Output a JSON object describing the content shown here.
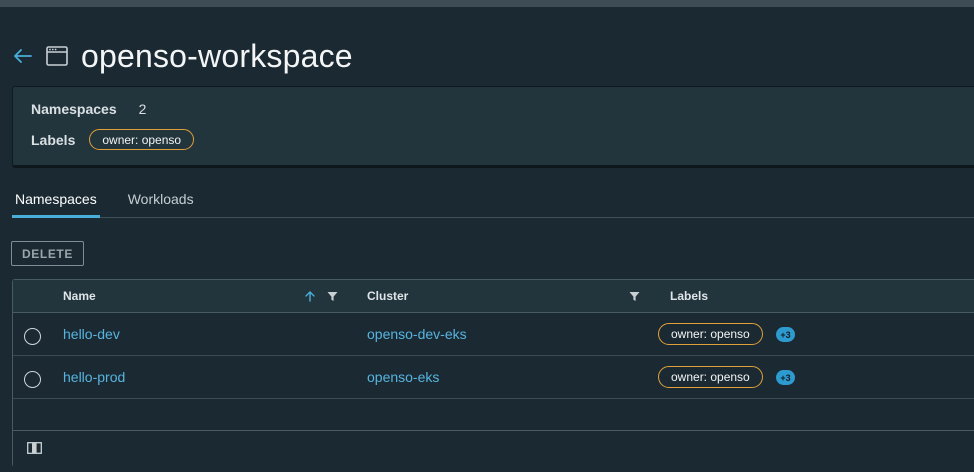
{
  "page": {
    "title": "openso-workspace"
  },
  "summary": {
    "namespaces_label": "Namespaces",
    "namespaces_count": "2",
    "labels_label": "Labels",
    "labels": [
      "owner: openso"
    ]
  },
  "tabs": [
    {
      "label": "Namespaces",
      "active": true
    },
    {
      "label": "Workloads",
      "active": false
    }
  ],
  "toolbar": {
    "delete_label": "DELETE"
  },
  "table": {
    "columns": [
      "Name",
      "Cluster",
      "Labels"
    ],
    "rows": [
      {
        "name": "hello-dev",
        "cluster": "openso-dev-eks",
        "label": "owner: openso",
        "more": "+3"
      },
      {
        "name": "hello-prod",
        "cluster": "openso-eks",
        "label": "owner: openso",
        "more": "+3"
      }
    ]
  },
  "icons": {
    "back": "arrow-left-icon",
    "title": "window-icon",
    "sort": "arrow-up-icon",
    "filter": "filter-icon",
    "footer": "column-toggle-icon"
  },
  "colors": {
    "accent": "#49afd9",
    "label_border": "#e0a03a",
    "badge": "#2e9bd0",
    "background": "#1b2a32",
    "card": "#22343c"
  }
}
